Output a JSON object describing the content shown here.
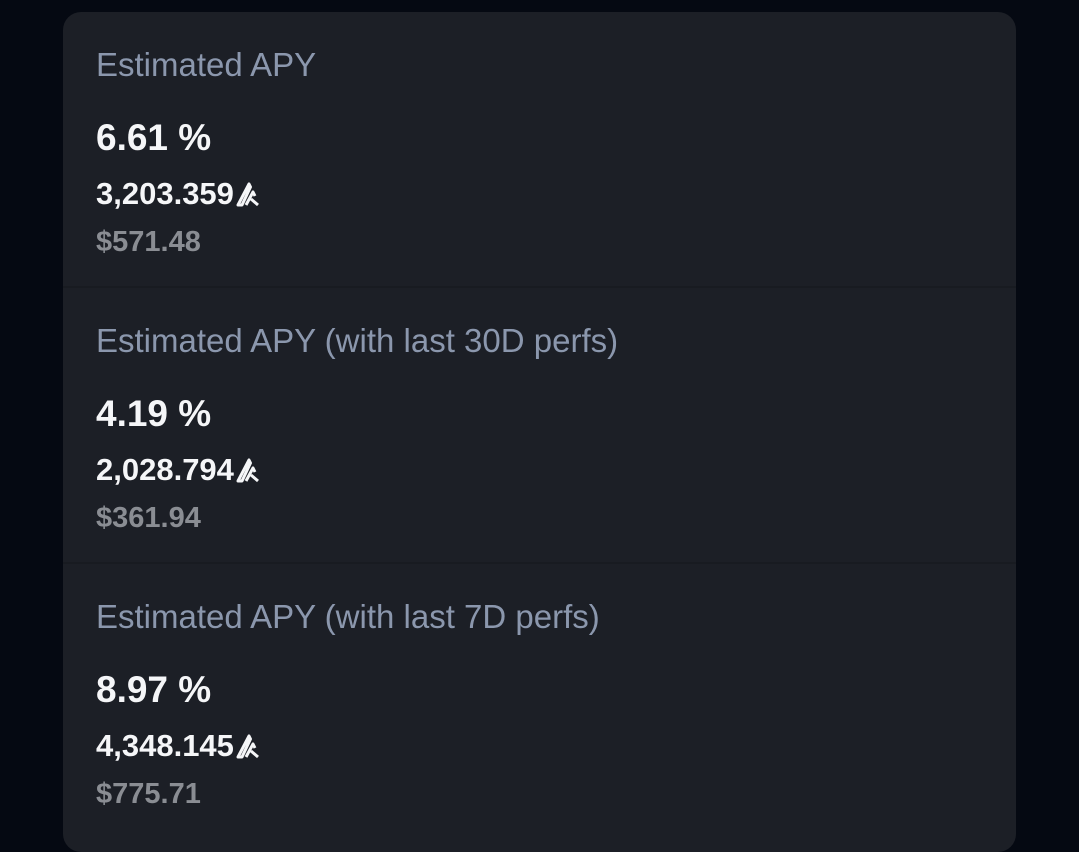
{
  "apy_cards": [
    {
      "label": "Estimated APY",
      "percent": "6.61 %",
      "amount": "3,203.359",
      "usd": "$571.48",
      "token_icon": "algorand-icon"
    },
    {
      "label": "Estimated APY (with last 30D perfs)",
      "percent": "4.19 %",
      "amount": "2,028.794",
      "usd": "$361.94",
      "token_icon": "algorand-icon"
    },
    {
      "label": "Estimated APY (with last 7D perfs)",
      "percent": "8.97 %",
      "amount": "4,348.145",
      "usd": "$775.71",
      "token_icon": "algorand-icon"
    }
  ]
}
